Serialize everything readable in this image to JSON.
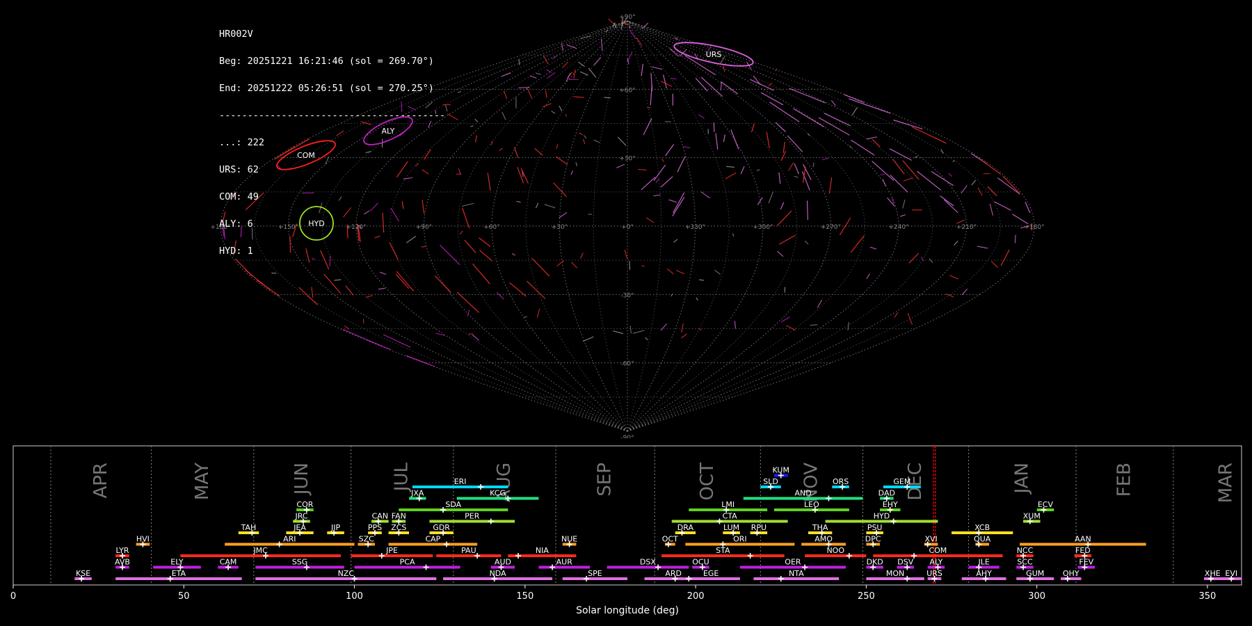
{
  "info": {
    "station": "HR002V",
    "begin": "Beg: 20251221 16:21:46 (sol = 269.70°)",
    "end": "End: 20251222 05:26:51 (sol = 270.25°)",
    "separator": "----------------------------------------",
    "counts": [
      "...: 222",
      "URS: 62",
      "COM: 49",
      "ALY: 6",
      "HYD: 1"
    ]
  },
  "sky_map": {
    "projection": "sinusoidal",
    "lon_tick_labels": [
      "+180°",
      "+150°",
      "+120°",
      "+90°",
      "+60°",
      "+30°",
      "+0°",
      "+330°",
      "+300°",
      "+270°",
      "+240°",
      "+210°",
      "+180°"
    ],
    "lat_tick_labels": [
      "+90°",
      "+60°",
      "+30°",
      "-30°",
      "-60°",
      "-90°"
    ],
    "showers": [
      {
        "code": "URS",
        "color": "#ff1a1a",
        "ring": "#e060e0"
      },
      {
        "code": "ALY",
        "color": "#c020c0",
        "ring": "#c020c0"
      },
      {
        "code": "COM",
        "color": "#ff2020",
        "ring": "#ff2020"
      },
      {
        "code": "HYD",
        "color": "#ffff40",
        "ring": "#a0e020"
      }
    ]
  },
  "chart_data": {
    "type": "bar",
    "xlabel": "Solar longitude (deg)",
    "xlim": [
      0,
      360
    ],
    "xticks": [
      0,
      50,
      100,
      150,
      200,
      250,
      300,
      350
    ],
    "current_sol": [
      269.7,
      270.25
    ],
    "months": [
      {
        "label": "APR",
        "boundary": 11
      },
      {
        "label": "MAY",
        "boundary": 40.5
      },
      {
        "label": "JUN",
        "boundary": 70.5
      },
      {
        "label": "JUL",
        "boundary": 99
      },
      {
        "label": "AUG",
        "boundary": 129
      },
      {
        "label": "SEP",
        "boundary": 159
      },
      {
        "label": "OCT",
        "boundary": 188
      },
      {
        "label": "NOV",
        "boundary": 219
      },
      {
        "label": "DEC",
        "boundary": 249
      },
      {
        "label": "JAN",
        "boundary": 280
      },
      {
        "label": "FEB",
        "boundary": 311.5
      },
      {
        "label": "MAR",
        "boundary": 340
      }
    ],
    "series": [
      {
        "code": "KUM",
        "start": 223,
        "end": 227,
        "peak": 225,
        "row": 9,
        "color": "#1a1aff"
      },
      {
        "code": "ERI",
        "start": 117,
        "end": 145,
        "peak": 137,
        "row": 8,
        "color": "#00d8ff"
      },
      {
        "code": "SLD",
        "start": 219,
        "end": 225,
        "peak": 222,
        "row": 8,
        "color": "#00d8ff"
      },
      {
        "code": "ORS",
        "start": 240,
        "end": 245,
        "peak": 243,
        "row": 8,
        "color": "#00d8ff"
      },
      {
        "code": "GEM",
        "start": 255,
        "end": 266,
        "peak": 262,
        "row": 8,
        "color": "#00d8ff"
      },
      {
        "code": "JXA",
        "start": 116,
        "end": 121,
        "peak": 119,
        "row": 7,
        "color": "#20e080"
      },
      {
        "code": "KCG",
        "start": 130,
        "end": 154,
        "peak": 145,
        "row": 7,
        "color": "#20e080"
      },
      {
        "code": "AND",
        "start": 214,
        "end": 249,
        "peak": 239,
        "row": 7,
        "color": "#20e080"
      },
      {
        "code": "DAD",
        "start": 254,
        "end": 258,
        "peak": 256,
        "row": 7,
        "color": "#20e080"
      },
      {
        "code": "COR",
        "start": 83,
        "end": 88,
        "peak": 86,
        "row": 6,
        "color": "#60d020"
      },
      {
        "code": "SDA",
        "start": 113,
        "end": 145,
        "peak": 126,
        "row": 6,
        "color": "#60d020"
      },
      {
        "code": "LMI",
        "start": 198,
        "end": 221,
        "peak": 209,
        "row": 6,
        "color": "#60d020"
      },
      {
        "code": "LEO",
        "start": 223,
        "end": 245,
        "peak": 235,
        "row": 6,
        "color": "#60d020"
      },
      {
        "code": "EHY",
        "start": 254,
        "end": 260,
        "peak": 257,
        "row": 6,
        "color": "#60d020"
      },
      {
        "code": "ECV",
        "start": 300,
        "end": 305,
        "peak": 302,
        "row": 6,
        "color": "#60d020"
      },
      {
        "code": "JRC",
        "start": 82,
        "end": 87,
        "peak": 85,
        "row": 5,
        "color": "#a0e030"
      },
      {
        "code": "CAN",
        "start": 105,
        "end": 110,
        "peak": 107,
        "row": 5,
        "color": "#a0e030"
      },
      {
        "code": "FAN",
        "start": 111,
        "end": 115,
        "peak": 113,
        "row": 5,
        "color": "#a0e030"
      },
      {
        "code": "PER",
        "start": 122,
        "end": 147,
        "peak": 140,
        "row": 5,
        "color": "#a0e030"
      },
      {
        "code": "CTA",
        "start": 193,
        "end": 227,
        "peak": 207,
        "row": 5,
        "color": "#a0e030"
      },
      {
        "code": "HYD",
        "start": 238,
        "end": 271,
        "peak": 258,
        "row": 5,
        "color": "#a0e030"
      },
      {
        "code": "XUM",
        "start": 296,
        "end": 301,
        "peak": 298,
        "row": 5,
        "color": "#a0e030"
      },
      {
        "code": "TAH",
        "start": 66,
        "end": 72,
        "peak": 70,
        "row": 4,
        "color": "#ffe020"
      },
      {
        "code": "JEA",
        "start": 80,
        "end": 88,
        "peak": 84,
        "row": 4,
        "color": "#ffe020"
      },
      {
        "code": "JIP",
        "start": 92,
        "end": 97,
        "peak": 94,
        "row": 4,
        "color": "#ffe020"
      },
      {
        "code": "PPS",
        "start": 104,
        "end": 108,
        "peak": 106,
        "row": 4,
        "color": "#ffe020"
      },
      {
        "code": "ZCS",
        "start": 110,
        "end": 116,
        "peak": 113,
        "row": 4,
        "color": "#ffe020"
      },
      {
        "code": "GDR",
        "start": 122,
        "end": 129,
        "peak": 126,
        "row": 4,
        "color": "#ffe020"
      },
      {
        "code": "DRA",
        "start": 194,
        "end": 200,
        "peak": 196,
        "row": 4,
        "color": "#ffe020"
      },
      {
        "code": "LUM",
        "start": 208,
        "end": 213,
        "peak": 211,
        "row": 4,
        "color": "#ffe020"
      },
      {
        "code": "RPU",
        "start": 216,
        "end": 221,
        "peak": 218,
        "row": 4,
        "color": "#ffe020"
      },
      {
        "code": "THA",
        "start": 233,
        "end": 240,
        "peak": 237,
        "row": 4,
        "color": "#ffe020"
      },
      {
        "code": "PSU",
        "start": 250,
        "end": 255,
        "peak": 253,
        "row": 4,
        "color": "#ffe020"
      },
      {
        "code": "XCB",
        "start": 275,
        "end": 293,
        "peak": 283,
        "row": 4,
        "color": "#ffe020"
      },
      {
        "code": "HVI",
        "start": 36,
        "end": 40,
        "peak": 38,
        "row": 3,
        "color": "#ffa020"
      },
      {
        "code": "ARI",
        "start": 62,
        "end": 100,
        "peak": 78,
        "row": 3,
        "color": "#ffa020"
      },
      {
        "code": "SZC",
        "start": 101,
        "end": 106,
        "peak": 104,
        "row": 3,
        "color": "#ffa020"
      },
      {
        "code": "CAP",
        "start": 110,
        "end": 136,
        "peak": 127,
        "row": 3,
        "color": "#ffa020"
      },
      {
        "code": "NUE",
        "start": 161,
        "end": 165,
        "peak": 163,
        "row": 3,
        "color": "#ffa020"
      },
      {
        "code": "OCT",
        "start": 191,
        "end": 194,
        "peak": 192,
        "row": 3,
        "color": "#ffa020"
      },
      {
        "code": "ORI",
        "start": 197,
        "end": 229,
        "peak": 208,
        "row": 3,
        "color": "#ffa020"
      },
      {
        "code": "AMO",
        "start": 231,
        "end": 244,
        "peak": 239,
        "row": 3,
        "color": "#ffa020"
      },
      {
        "code": "DPC",
        "start": 250,
        "end": 254,
        "peak": 252,
        "row": 3,
        "color": "#ffa020"
      },
      {
        "code": "XVI",
        "start": 267,
        "end": 271,
        "peak": 268,
        "row": 3,
        "color": "#ffa020"
      },
      {
        "code": "QUA",
        "start": 282,
        "end": 286,
        "peak": 283,
        "row": 3,
        "color": "#ffa020"
      },
      {
        "code": "AAN",
        "start": 295,
        "end": 332,
        "peak": 315,
        "row": 3,
        "color": "#ffa020"
      },
      {
        "code": "LYR",
        "start": 30,
        "end": 34,
        "peak": 32,
        "row": 2,
        "color": "#ff2a1a"
      },
      {
        "code": "JMC",
        "start": 49,
        "end": 96,
        "peak": 74,
        "row": 2,
        "color": "#ff2a1a"
      },
      {
        "code": "JPE",
        "start": 99,
        "end": 123,
        "peak": 108,
        "row": 2,
        "color": "#ff2a1a"
      },
      {
        "code": "PAU",
        "start": 124,
        "end": 143,
        "peak": 136,
        "row": 2,
        "color": "#ff2a1a"
      },
      {
        "code": "NIA",
        "start": 145,
        "end": 165,
        "peak": 148,
        "row": 2,
        "color": "#ff2a1a"
      },
      {
        "code": "STA",
        "start": 190,
        "end": 226,
        "peak": 216,
        "row": 2,
        "color": "#ff2a1a"
      },
      {
        "code": "NOO",
        "start": 232,
        "end": 250,
        "peak": 245,
        "row": 2,
        "color": "#ff2a1a"
      },
      {
        "code": "COM",
        "start": 252,
        "end": 290,
        "peak": 264,
        "row": 2,
        "color": "#ff2a1a"
      },
      {
        "code": "NCC",
        "start": 294,
        "end": 299,
        "peak": 296,
        "row": 2,
        "color": "#ff2a1a"
      },
      {
        "code": "FED",
        "start": 311,
        "end": 316,
        "peak": 314,
        "row": 2,
        "color": "#ff2a1a"
      },
      {
        "code": "AVB",
        "start": 30,
        "end": 34,
        "peak": 32,
        "row": 1,
        "color": "#c020e0"
      },
      {
        "code": "ELY",
        "start": 41,
        "end": 55,
        "peak": 49,
        "row": 1,
        "color": "#c020e0"
      },
      {
        "code": "CAM",
        "start": 60,
        "end": 66,
        "peak": 63,
        "row": 1,
        "color": "#c020e0"
      },
      {
        "code": "SSG",
        "start": 71,
        "end": 97,
        "peak": 86,
        "row": 1,
        "color": "#c020e0"
      },
      {
        "code": "PCA",
        "start": 100,
        "end": 131,
        "peak": 121,
        "row": 1,
        "color": "#c020e0"
      },
      {
        "code": "AUD",
        "start": 140,
        "end": 147,
        "peak": 143,
        "row": 1,
        "color": "#c020e0"
      },
      {
        "code": "AUR",
        "start": 154,
        "end": 169,
        "peak": 158,
        "row": 1,
        "color": "#c020e0"
      },
      {
        "code": "DSX",
        "start": 174,
        "end": 198,
        "peak": 189,
        "row": 1,
        "color": "#c020e0"
      },
      {
        "code": "OCU",
        "start": 199,
        "end": 204,
        "peak": 202,
        "row": 1,
        "color": "#c020e0"
      },
      {
        "code": "OER",
        "start": 213,
        "end": 244,
        "peak": 232,
        "row": 1,
        "color": "#c020e0"
      },
      {
        "code": "DKD",
        "start": 250,
        "end": 255,
        "peak": 252,
        "row": 1,
        "color": "#c020e0"
      },
      {
        "code": "DSV",
        "start": 259,
        "end": 264,
        "peak": 262,
        "row": 1,
        "color": "#c020e0"
      },
      {
        "code": "ALY",
        "start": 268,
        "end": 273,
        "peak": 271,
        "row": 1,
        "color": "#c020e0"
      },
      {
        "code": "JLE",
        "start": 280,
        "end": 289,
        "peak": 283,
        "row": 1,
        "color": "#c020e0"
      },
      {
        "code": "SCC",
        "start": 294,
        "end": 299,
        "peak": 296,
        "row": 1,
        "color": "#c020e0"
      },
      {
        "code": "FEV",
        "start": 312,
        "end": 317,
        "peak": 314,
        "row": 1,
        "color": "#c020e0"
      },
      {
        "code": "KSE",
        "start": 18,
        "end": 23,
        "peak": 20,
        "row": 0,
        "color": "#e070e0"
      },
      {
        "code": "ETA",
        "start": 30,
        "end": 67,
        "peak": 46,
        "row": 0,
        "color": "#e070e0"
      },
      {
        "code": "NZC",
        "start": 71,
        "end": 124,
        "peak": 100,
        "row": 0,
        "color": "#e070e0"
      },
      {
        "code": "NDA",
        "start": 126,
        "end": 158,
        "peak": 141,
        "row": 0,
        "color": "#e070e0"
      },
      {
        "code": "SPE",
        "start": 161,
        "end": 180,
        "peak": 168,
        "row": 0,
        "color": "#e070e0"
      },
      {
        "code": "ARD",
        "start": 185,
        "end": 202,
        "peak": 194,
        "row": 0,
        "color": "#e070e0"
      },
      {
        "code": "EGE",
        "start": 196,
        "end": 213,
        "peak": 198,
        "row": 0,
        "color": "#e070e0"
      },
      {
        "code": "NTA",
        "start": 217,
        "end": 242,
        "peak": 225,
        "row": 0,
        "color": "#e070e0"
      },
      {
        "code": "MON",
        "start": 250,
        "end": 267,
        "peak": 262,
        "row": 0,
        "color": "#e070e0"
      },
      {
        "code": "URS",
        "start": 268,
        "end": 272,
        "peak": 270,
        "row": 0,
        "color": "#e070e0"
      },
      {
        "code": "AHY",
        "start": 278,
        "end": 291,
        "peak": 285,
        "row": 0,
        "color": "#e070e0"
      },
      {
        "code": "GUM",
        "start": 294,
        "end": 305,
        "peak": 298,
        "row": 0,
        "color": "#e070e0"
      },
      {
        "code": "OHY",
        "start": 307,
        "end": 313,
        "peak": 309,
        "row": 0,
        "color": "#e070e0"
      },
      {
        "code": "XHE",
        "start": 349,
        "end": 354,
        "peak": 351,
        "row": 0,
        "color": "#e070e0"
      },
      {
        "code": "EVI",
        "start": 354,
        "end": 360,
        "peak": 357,
        "row": 0,
        "color": "#e070e0"
      }
    ]
  }
}
